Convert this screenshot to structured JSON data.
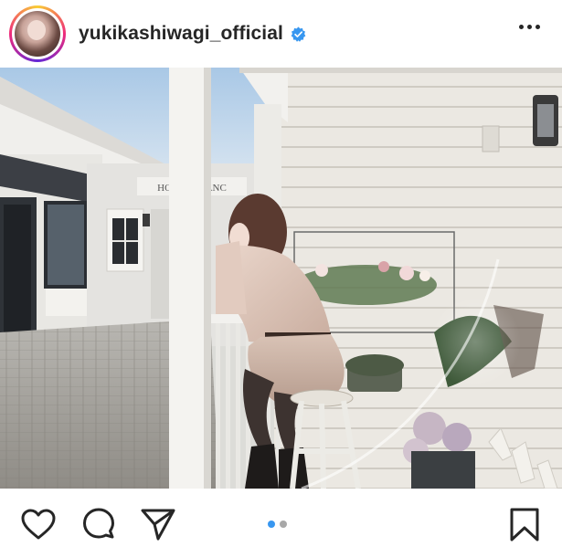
{
  "header": {
    "username": "yukikashiwagi_official",
    "verified_icon": "verified-badge-icon",
    "more_icon": "more-options-icon"
  },
  "photo": {
    "sign_text": "HOTEL BLANC"
  },
  "actions": {
    "like_icon": "heart-icon",
    "comment_icon": "comment-icon",
    "share_icon": "send-icon",
    "save_icon": "bookmark-icon"
  },
  "carousel": {
    "total": 2,
    "active_index": 0
  },
  "colors": {
    "accent": "#3897f0",
    "verified": "#3897f0",
    "text": "#262626"
  }
}
